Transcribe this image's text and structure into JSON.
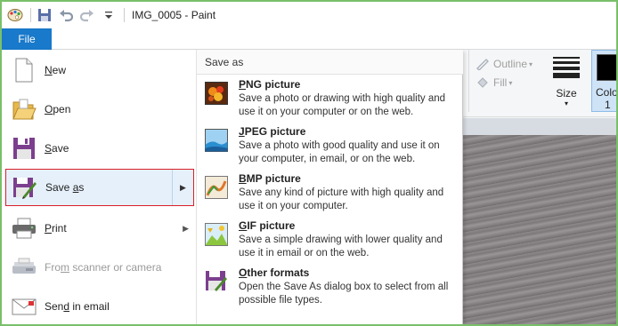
{
  "titlebar": {
    "title": "IMG_0005 - Paint"
  },
  "file_tab": {
    "label": "File"
  },
  "ribbon": {
    "outline_label": "Outline",
    "fill_label": "Fill",
    "size_label": "Size",
    "color_label": "Colo",
    "color_num": "1"
  },
  "menu_left": {
    "new": {
      "pre": "",
      "acc": "N",
      "post": "ew"
    },
    "open": {
      "pre": "",
      "acc": "O",
      "post": "pen"
    },
    "save": {
      "pre": "",
      "acc": "S",
      "post": "ave"
    },
    "saveas": {
      "pre": "Save ",
      "acc": "a",
      "post": "s"
    },
    "print": {
      "pre": "",
      "acc": "P",
      "post": "rint"
    },
    "scanner": {
      "pre": "Fro",
      "acc": "m",
      "post": " scanner or camera"
    },
    "email": {
      "pre": "Sen",
      "acc": "d",
      "post": " in email"
    }
  },
  "save_as": {
    "header": "Save as",
    "options": [
      {
        "acc": "P",
        "title": "NG picture",
        "desc": "Save a photo or drawing with high quality and use it on your computer or on the web."
      },
      {
        "acc": "J",
        "title": "PEG picture",
        "desc": "Save a photo with good quality and use it on your computer, in email, or on the web."
      },
      {
        "acc": "B",
        "title": "MP picture",
        "desc": "Save any kind of picture with high quality and use it on your computer."
      },
      {
        "acc": "G",
        "title": "IF picture",
        "desc": "Save a simple drawing with lower quality and use it in email or on the web."
      },
      {
        "acc": "O",
        "title": "ther formats",
        "desc": "Open the Save As dialog box to select from all possible file types."
      }
    ]
  }
}
